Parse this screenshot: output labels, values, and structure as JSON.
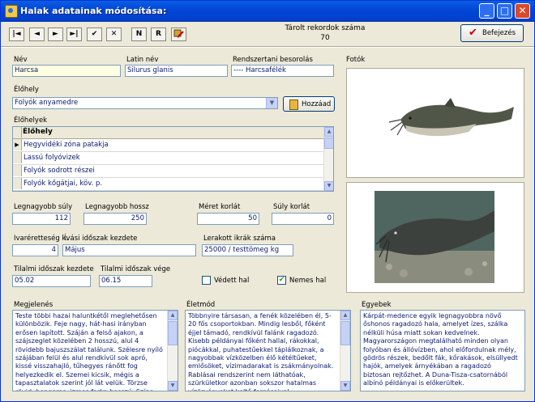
{
  "window": {
    "title": "Halak adatainak módosítása:"
  },
  "toolbar": {
    "first": "|◄",
    "prev": "◄",
    "next": "►",
    "last": "►|",
    "post": "✔",
    "cancel": "✕",
    "btn_n": "N",
    "btn_r": "R"
  },
  "records": {
    "label": "Tárolt rekordok száma",
    "count": "70"
  },
  "finish_button": "Befejezés",
  "fields": {
    "nev": {
      "label": "Név",
      "value": "Harcsa"
    },
    "latin": {
      "label": "Latin név",
      "value": "Silurus glanis"
    },
    "rendszertani": {
      "label": "Rendszertani besorolás",
      "value": "---- Harcsafélék"
    },
    "elohely": {
      "label": "Élőhely",
      "value": "Folyók anyamedre"
    },
    "legnagyobb_suly": {
      "label": "Legnagyobb súly",
      "value": "112"
    },
    "legnagyobb_hossz": {
      "label": "Legnagyobb hossz",
      "value": "250"
    },
    "meret_korlat": {
      "label": "Méret korlát",
      "value": "50"
    },
    "suly_korlat": {
      "label": "Súly korlát",
      "value": "0"
    },
    "ivaretesseg": {
      "label": "Ivaréretteség k.",
      "value": "4"
    },
    "ivasi_kezdete": {
      "label": "Ívási időszak kezdete",
      "value": "Május"
    },
    "ikrak_szama": {
      "label": "Lerakott ikrák száma",
      "value": "25000 / testtömeg kg"
    },
    "tilalmi_kezdete": {
      "label": "Tilalmi időszak kezdete",
      "value": "05.02"
    },
    "tilalmi_vege": {
      "label": "Tilalmi időszak vége",
      "value": "06.15"
    }
  },
  "add_button": "Hozzáad",
  "elohelyek": {
    "label": "Élőhelyek",
    "column": "Élőhely",
    "rows": [
      "Hegyvidéki zóna patakja",
      "Lassú folyóvizek",
      "Folyók sodrott részei",
      "Folyók kőgátjai, köv. p."
    ]
  },
  "checkboxes": {
    "vedett": {
      "label": "Védett hal",
      "checked": false
    },
    "nemes": {
      "label": "Nemes hal",
      "checked": true,
      "mark": "✔"
    }
  },
  "photos": {
    "label": "Fotók"
  },
  "memos": {
    "megjelenes": {
      "label": "Megjelenés",
      "text": "Teste többi hazai haluntkétől meglehetősen különbözik. Feje nagy, hát-hasi irányban erősen lapított. Száján a felső ajakon, a szájszeglet közelében 2 hosszú, alul 4 rövidebb bajuszszálat találunk. Szélesre nyíló szájában felül és alul rendkívül sok apró, kissé visszahajló, tűhegyes ránőtt fog helyezkedik el. Szemei kicsik, mégis a tapasztalatok szerint jól lát velük. Törzse rövid, hengeres, izmos farka hosszú. Színe"
    },
    "eletmod": {
      "label": "Életmód",
      "text": "Többnyire társasan, a fenék közelében él, 5-20 fős csoportokban. Mindig lesből, főként éjjel támadó, rendkívül falánk ragadozó. Kisebb példányai főként hallal, rákokkal, piócákkal, puhatestűekkel táplálkoznak, a nagyobbak vízközelben élő kétéltűeket, emlősöket, vízimadarakat is zsákmányolnak. Rablásai rendszerint nem láthatóak, szürkületkor azonban sokszor hatalmas vízörvényeket keltő forgásaival"
    },
    "egyebek": {
      "label": "Egyebek",
      "text": "Kárpát-medence egyik legnagyobbra növő őshonos ragadozó hala, amelyet ízes, szálka nélküli húsa miatt sokan kedvelnek. Magyarországon megtalálható minden olyan folyóban és állóvízben, ahol előfordulnak mély, gödrös részek, bedőlt fák, kőrakások, elsüllyedt hajók, amelyek árnyékában a ragadozó biztosan rejtőzhet. A Duna-Tisza-csatornából albínó példányai is előkerültek."
    }
  },
  "colors": {
    "titlebar": "#0247d6",
    "field_text": "#0a1a6a",
    "window_bg": "#ece9d8"
  }
}
